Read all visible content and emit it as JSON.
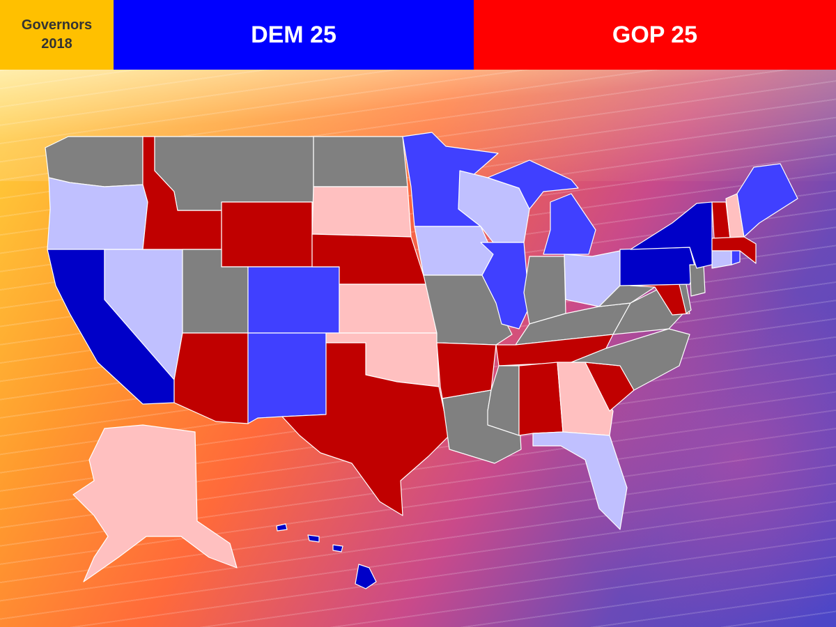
{
  "header": {
    "title_line1": "Governors",
    "title_line2": "2018",
    "dem_label": "DEM 25",
    "gop_label": "GOP 25"
  },
  "colors": {
    "title_bg": "#ffc000",
    "dem_bg": "#0000ff",
    "gop_bg": "#ff0000",
    "safe_dem": "#0000c8",
    "likely_dem": "#4040ff",
    "lean_dem": "#c0c0ff",
    "safe_gop": "#c00000",
    "lean_gop": "#ffc0c0",
    "no_race": "#808080"
  },
  "states": [
    {
      "id": "WA",
      "rating": "no_race"
    },
    {
      "id": "OR",
      "rating": "lean_dem"
    },
    {
      "id": "CA",
      "rating": "safe_dem"
    },
    {
      "id": "NV",
      "rating": "lean_dem"
    },
    {
      "id": "ID",
      "rating": "safe_gop"
    },
    {
      "id": "MT",
      "rating": "no_race"
    },
    {
      "id": "ND",
      "rating": "no_race"
    },
    {
      "id": "WY",
      "rating": "safe_gop"
    },
    {
      "id": "SD",
      "rating": "lean_gop"
    },
    {
      "id": "UT",
      "rating": "no_race"
    },
    {
      "id": "CO",
      "rating": "likely_dem"
    },
    {
      "id": "NE",
      "rating": "safe_gop"
    },
    {
      "id": "KS",
      "rating": "lean_gop"
    },
    {
      "id": "AZ",
      "rating": "safe_gop"
    },
    {
      "id": "NM",
      "rating": "likely_dem"
    },
    {
      "id": "OK",
      "rating": "lean_gop"
    },
    {
      "id": "TX",
      "rating": "safe_gop"
    },
    {
      "id": "MN",
      "rating": "likely_dem"
    },
    {
      "id": "IA",
      "rating": "lean_dem"
    },
    {
      "id": "MO",
      "rating": "no_race"
    },
    {
      "id": "AR",
      "rating": "safe_gop"
    },
    {
      "id": "LA",
      "rating": "no_race"
    },
    {
      "id": "WI",
      "rating": "lean_dem"
    },
    {
      "id": "IL",
      "rating": "likely_dem"
    },
    {
      "id": "MI",
      "rating": "likely_dem"
    },
    {
      "id": "IN",
      "rating": "no_race"
    },
    {
      "id": "OH",
      "rating": "lean_dem"
    },
    {
      "id": "KY",
      "rating": "no_race"
    },
    {
      "id": "TN",
      "rating": "safe_gop"
    },
    {
      "id": "MS",
      "rating": "no_race"
    },
    {
      "id": "AL",
      "rating": "safe_gop"
    },
    {
      "id": "GA",
      "rating": "lean_gop"
    },
    {
      "id": "FL",
      "rating": "lean_dem"
    },
    {
      "id": "SC",
      "rating": "safe_gop"
    },
    {
      "id": "NC",
      "rating": "no_race"
    },
    {
      "id": "VA",
      "rating": "no_race"
    },
    {
      "id": "WV",
      "rating": "no_race"
    },
    {
      "id": "MD",
      "rating": "safe_gop"
    },
    {
      "id": "DE",
      "rating": "no_race"
    },
    {
      "id": "NJ",
      "rating": "no_race"
    },
    {
      "id": "PA",
      "rating": "safe_dem"
    },
    {
      "id": "NY",
      "rating": "safe_dem"
    },
    {
      "id": "VT",
      "rating": "safe_gop"
    },
    {
      "id": "NH",
      "rating": "lean_gop"
    },
    {
      "id": "ME",
      "rating": "likely_dem"
    },
    {
      "id": "MA",
      "rating": "safe_gop"
    },
    {
      "id": "CT",
      "rating": "lean_dem"
    },
    {
      "id": "RI",
      "rating": "likely_dem"
    },
    {
      "id": "AK",
      "rating": "lean_gop"
    },
    {
      "id": "HI",
      "rating": "safe_dem"
    }
  ]
}
